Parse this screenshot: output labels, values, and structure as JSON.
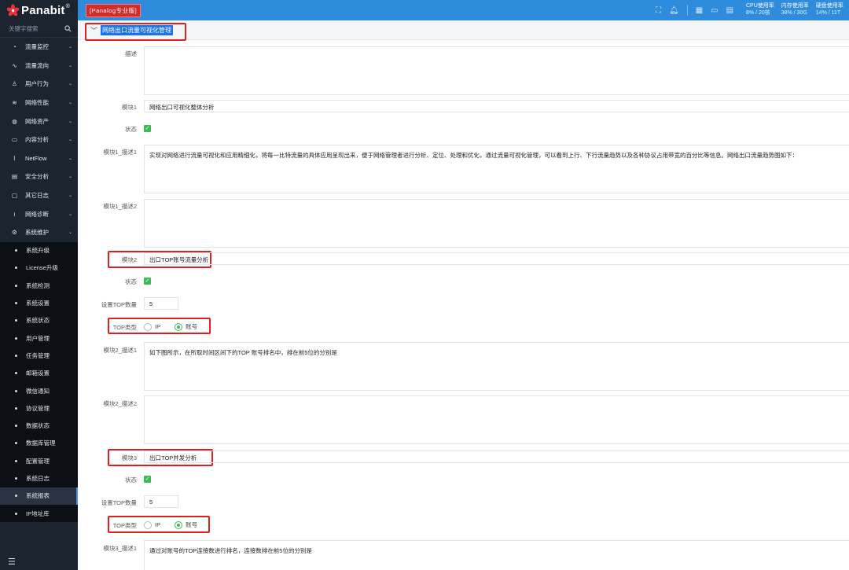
{
  "app": {
    "logo": "Panabit",
    "reg": "®",
    "edition_badge": "[Panalog专业版]"
  },
  "sidebar": {
    "search_placeholder": "关键字搜索",
    "items": [
      {
        "label": "流量监控",
        "icon": "speedometer-icon"
      },
      {
        "label": "流量流向",
        "icon": "pulse-icon"
      },
      {
        "label": "用户行为",
        "icon": "user-icon"
      },
      {
        "label": "网络性能",
        "icon": "wifi-icon"
      },
      {
        "label": "网络资产",
        "icon": "globe-icon"
      },
      {
        "label": "内容分析",
        "icon": "book-icon"
      },
      {
        "label": "NetFlow",
        "icon": "chart-icon"
      },
      {
        "label": "安全分析",
        "icon": "shield-doc-icon"
      },
      {
        "label": "其它日志",
        "icon": "note-icon"
      },
      {
        "label": "网络诊断",
        "icon": "signal-icon"
      },
      {
        "label": "系统维护",
        "icon": "gear-icon"
      }
    ],
    "sub_items": [
      "系统升级",
      "License升级",
      "系统检测",
      "系统设置",
      "系统状态",
      "用户管理",
      "任务管理",
      "邮箱设置",
      "微信通知",
      "协议管理",
      "数据状态",
      "数据库管理",
      "配置管理",
      "系统日志",
      "系统报表",
      "IP地址库"
    ],
    "active_sub": "系统报表"
  },
  "header": {
    "stats": [
      {
        "label": "CPU使用率",
        "value": "8% / 20核"
      },
      {
        "label": "内存使用率",
        "value": "38% / 30G"
      },
      {
        "label": "硬盘使用率",
        "value": "14% / 11T"
      }
    ]
  },
  "form": {
    "section_title": "网络出口流量可视化管理",
    "labels": {
      "desc": "描述",
      "m1": "模块1",
      "status": "状态",
      "m1_desc1": "模块1_描述1",
      "m1_desc2": "模块1_描述2",
      "m2": "模块2",
      "top_count": "设置TOP数量",
      "top_type": "TOP类型",
      "m2_desc1": "模块2_描述1",
      "m2_desc2": "模块2_描述2",
      "m3": "模块3",
      "m3_desc1": "模块3_描述1",
      "ip": "IP",
      "account": "账号"
    },
    "desc_value": "",
    "m1_value": "网络出口可视化整体分析",
    "m1_desc1_value": "实现对网络进行流量可视化和应用精细化，将每一比特流量的具体应用呈现出来，便于网络管理者进行分析、定位、处理和优化，通过流量可视化管理，可以看到上行、下行流量趋势以及各种协议占用带宽的百分比等信息。网络出口流量趋势图如下：",
    "m1_desc2_value": "",
    "m2_value": "出口TOP账号流量分析",
    "m2_top_count": "5",
    "m2_desc1_value": "如下图所示，在所取时间区间下的TOP 账号排名中，排在前5位的分别是",
    "m2_desc2_value": "",
    "m3_value": "出口TOP并发分析",
    "m3_top_count": "5",
    "m3_desc1_value": "通过对账号的TOP连接数进行排名，连接数排在前5位的分别是"
  },
  "colors": {
    "header": "#2f8bdc",
    "sidebar": "#1c2430",
    "highlight": "#e02020",
    "check": "#3cba54"
  }
}
